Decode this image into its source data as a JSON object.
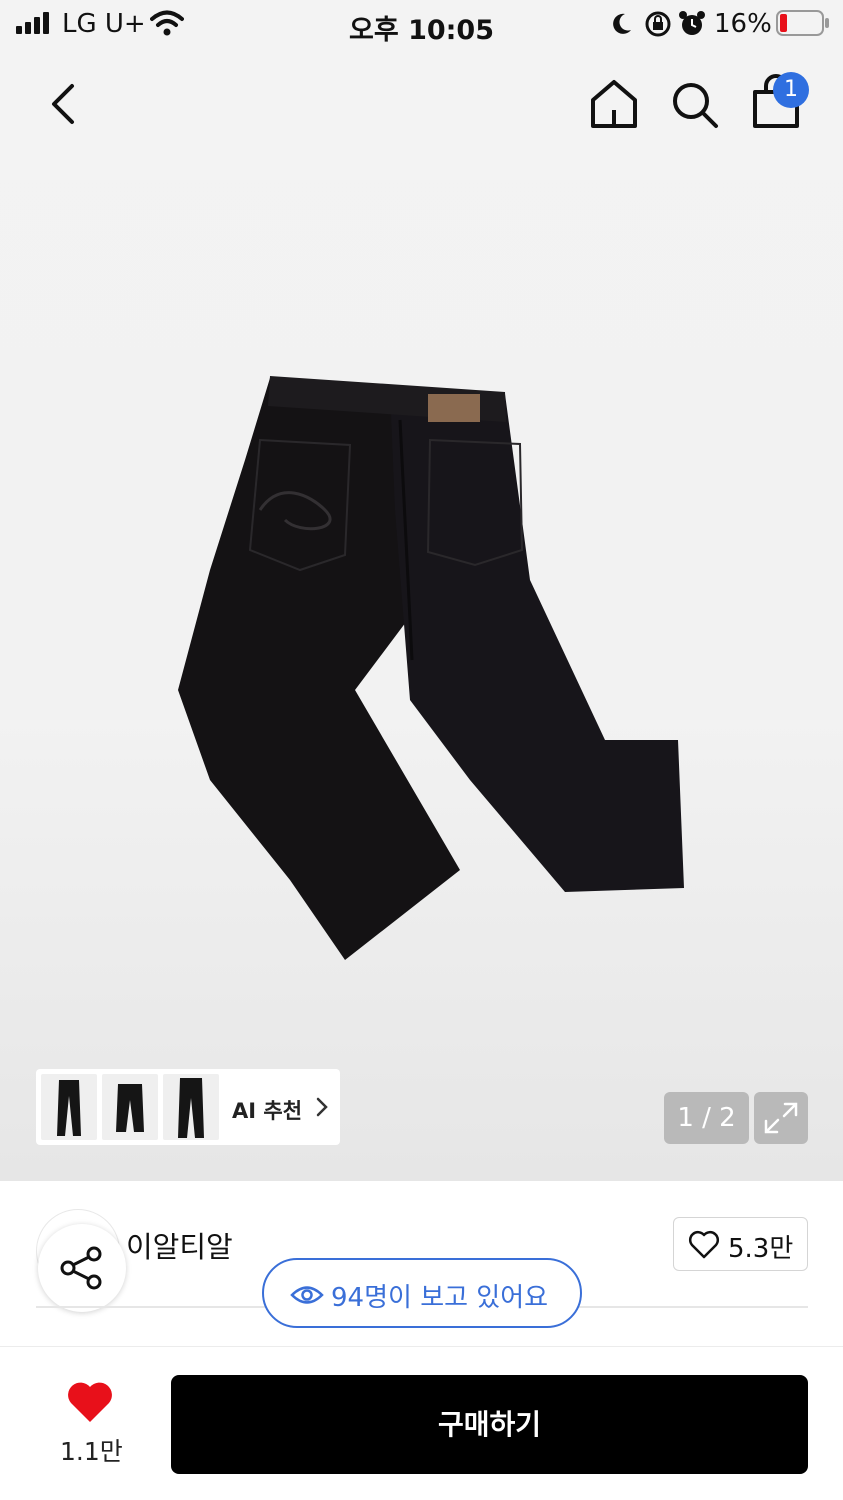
{
  "status_bar": {
    "carrier": "LG U+",
    "time": "오후 10:05",
    "battery_percent": "16%",
    "battery_level": 0.16,
    "icons": [
      "signal-icon",
      "wifi-icon",
      "moon-icon",
      "rotation-lock-icon",
      "alarm-icon",
      "battery-icon"
    ]
  },
  "nav": {
    "icons": [
      "back-chevron-icon",
      "home-icon",
      "search-icon",
      "shopping-bag-icon"
    ],
    "cart_count": "1"
  },
  "gallery": {
    "page_indicator": "1 / 2",
    "ai_recommend_label": "AI 추천",
    "expand_icon": "expand-icon"
  },
  "product": {
    "store_name": "이알티알",
    "wish_count": "5.3만",
    "viewers_text": "94명이 보고 있어요"
  },
  "bottom_bar": {
    "like_count": "1.1만",
    "buy_label": "구매하기"
  },
  "colors": {
    "accent_blue": "#3a6fd8",
    "heart_red": "#e8101a",
    "buy_button": "#000000"
  }
}
